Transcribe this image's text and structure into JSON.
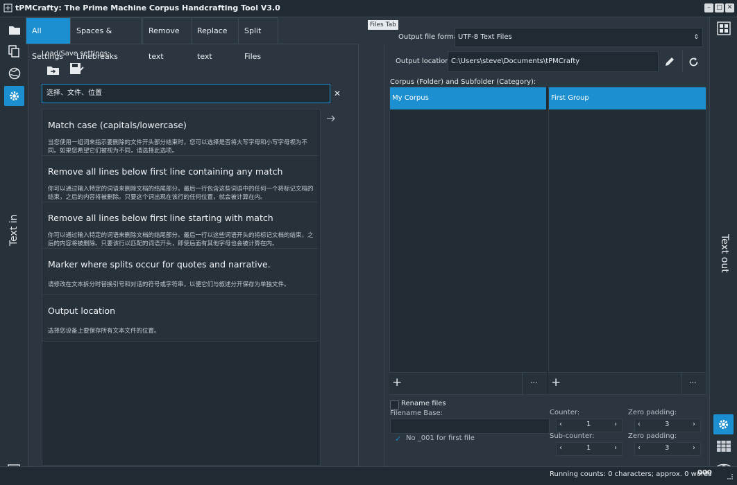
{
  "window": {
    "title": "tPMCrafty: The Prime Machine Corpus Handcrafting Tool V3.0"
  },
  "left_sidebar": {
    "vertical_label": "Text in"
  },
  "right_sidebar": {
    "vertical_label": "Text out"
  },
  "tabs": [
    {
      "label": "All Settings",
      "active": true
    },
    {
      "label": "Spaces & Linebreaks"
    },
    {
      "label": "Remove text"
    },
    {
      "label": "Replace text"
    },
    {
      "label": "Split Files"
    }
  ],
  "load_save": {
    "label": "Load/Save settings:"
  },
  "search": {
    "value": "选择、文件、位置",
    "clear_symbol": "✕"
  },
  "settings_items": [
    {
      "title": "Match case (capitals/lowercase)",
      "desc": "当您使用一组词来指示要删除的文件开头部分结束时，您可以选择是否将大写字母和小写字母视为不同。如果您希望它们被视为不同，请选择此选项。"
    },
    {
      "title": "Remove all lines below first line containing any match",
      "desc": "你可以通过输入特定的词语来删除文档的结尾部分。最后一行包含这些词语中的任何一个将标记文档的结束，之后的内容将被删除。只要这个词出现在该行的任何位置，就会被计算在内。"
    },
    {
      "title": "Remove all lines below first line starting with match",
      "desc": "你可以通过输入特定的词语来删除文档的结尾部分。最后一行以这些词语开头的将标记文档的结束，之后的内容将被删除。只要该行以匹配的词语开头，即使后面有其他字母也会被计算在内。"
    },
    {
      "title": "Marker where splits occur for quotes and narrative.",
      "desc": "请修改在文本拆分时替换引号和对话的符号或字符串，以便它们与叙述分开保存为单独文件。"
    },
    {
      "title": "Output location",
      "desc": "选择您设备上要保存所有文本文件的位置。"
    }
  ],
  "files_tab": {
    "tooltip": "Files Tab",
    "output_format_label": "Output file format:",
    "output_format_value": "UTF-8 Text Files",
    "output_location_label": "Output location:",
    "output_location_value": "C:\\Users\\steve\\Documents\\tPMCrafty",
    "corpus_label": "Corpus (Folder) and Subfolder (Category):",
    "corpus_list": {
      "selected": "My Corpus",
      "add": "+",
      "more": "···"
    },
    "group_list": {
      "selected": "First Group",
      "add": "+",
      "more": "···"
    },
    "rename_files": {
      "label": "Rename files",
      "checked": false
    },
    "filename_base_label": "Filename Base:",
    "filename_base_value": "",
    "no001": {
      "label": "No _001 for first file",
      "checked": true
    },
    "counter": {
      "label": "Counter:",
      "value": "1"
    },
    "zero_padding_1": {
      "label": "Zero padding:",
      "value": "3"
    },
    "sub_counter": {
      "label": "Sub-counter:",
      "value": "1"
    },
    "zero_padding_2": {
      "label": "Zero padding:",
      "value": "3"
    }
  },
  "status": {
    "running_counts": "Running counts: 0 characters; approx. 0 words",
    "badge": "000"
  },
  "colors": {
    "accent": "#1b8fcf",
    "background": "#2b3640",
    "panel": "#222c35"
  }
}
